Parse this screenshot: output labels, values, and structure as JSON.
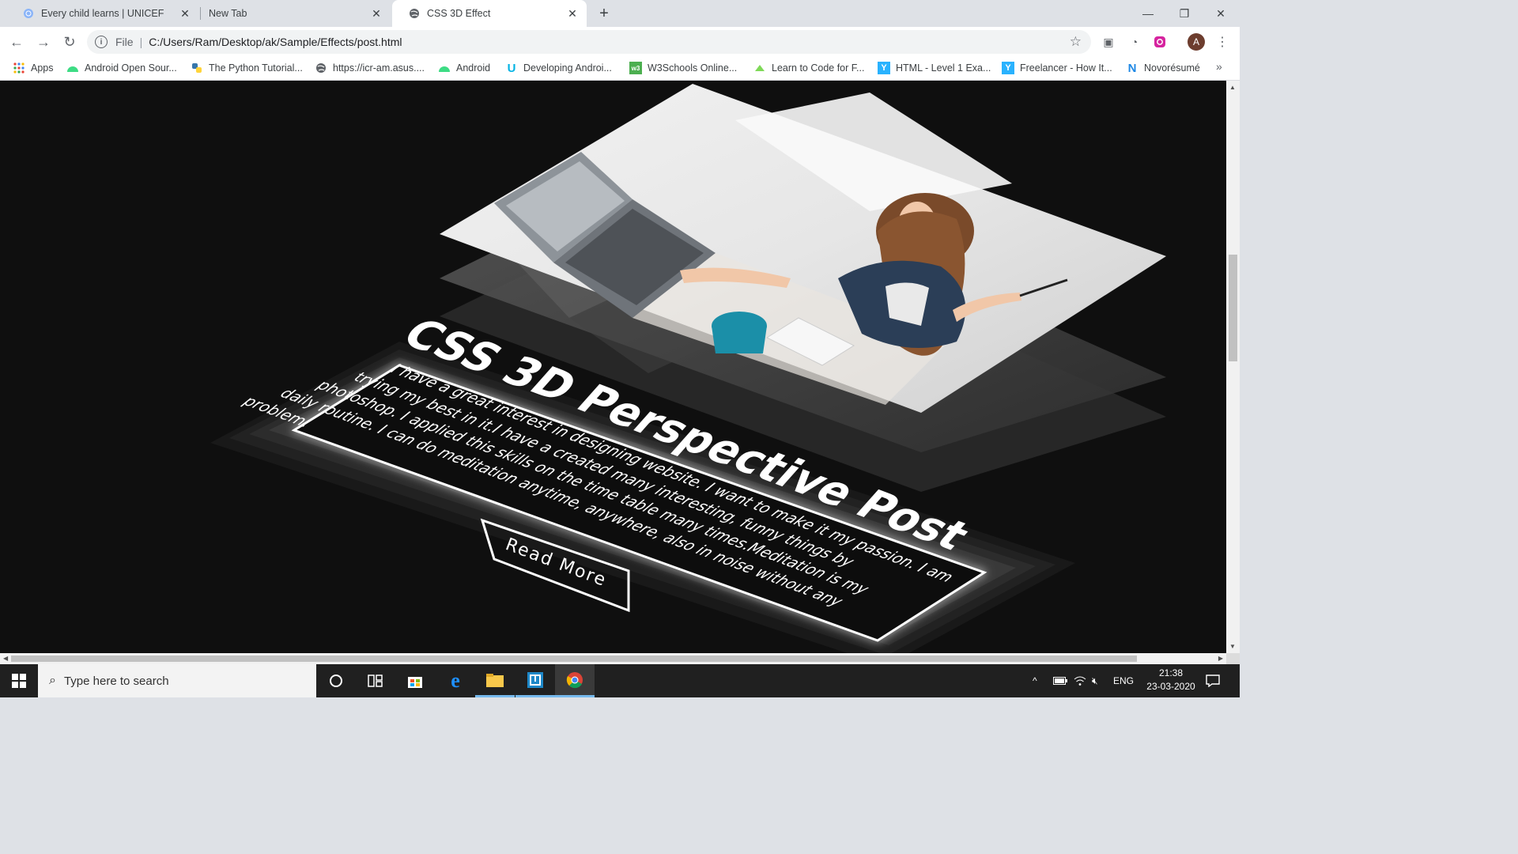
{
  "browser": {
    "tabs": [
      {
        "title": "Every child learns | UNICEF",
        "icon": "globe-icon",
        "active": false
      },
      {
        "title": "New Tab",
        "icon": "",
        "active": false
      },
      {
        "title": "CSS 3D Effect",
        "icon": "globe-icon",
        "active": true
      }
    ],
    "address": {
      "scheme": "File",
      "url": "C:/Users/Ram/Desktop/ak/Sample/Effects/post.html"
    },
    "profile_initial": "A",
    "bookmarks": [
      {
        "label": "Apps",
        "icon": "apps-grid-icon"
      },
      {
        "label": "Android Open Sour...",
        "icon": "android-icon"
      },
      {
        "label": "The Python Tutorial...",
        "icon": "python-icon"
      },
      {
        "label": "https://icr-am.asus....",
        "icon": "globe-icon"
      },
      {
        "label": "Android",
        "icon": "android-icon"
      },
      {
        "label": "Developing Androi...",
        "icon": "udacity-icon"
      },
      {
        "label": "W3Schools Online...",
        "icon": "w3schools-icon"
      },
      {
        "label": "Learn to Code for F...",
        "icon": "freecodecamp-icon"
      },
      {
        "label": "HTML - Level 1 Exa...",
        "icon": "freelancer-icon"
      },
      {
        "label": "Freelancer - How It...",
        "icon": "freelancer-icon"
      },
      {
        "label": "Novorésumé",
        "icon": "novoresume-icon"
      }
    ]
  },
  "page": {
    "title": "CSS 3D Perspective Post",
    "body_lines": [
      "I have a great interest in designing website. I want to make it my passion. I am",
      "trying my best in it.I have a created many interesting, funny things by",
      "photoshop. I applied this skills on the time table many times.Meditation is my",
      "daily routine. I can do meditation anytime, anywhere, also in noise without any",
      "problem."
    ],
    "button_label": "Read More",
    "colors": {
      "background": "#0f0f0f",
      "text": "#ffffff",
      "glow": "#ffffff"
    }
  },
  "taskbar": {
    "search_placeholder": "Type here to search",
    "apps": [
      "cortana-icon",
      "task-view-icon",
      "store-icon",
      "edge-icon",
      "file-explorer-icon",
      "sticky-app-icon",
      "chrome-icon"
    ],
    "language": "ENG",
    "time": "21:38",
    "date": "23-03-2020"
  }
}
